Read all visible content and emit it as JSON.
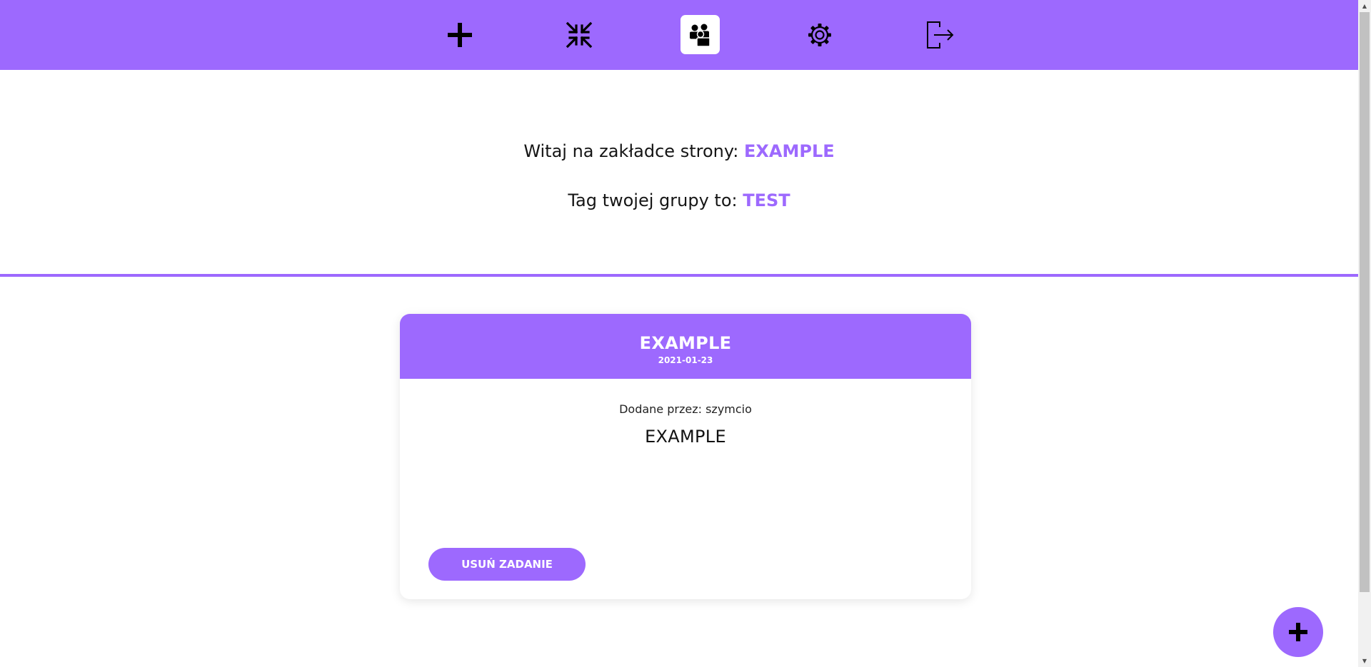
{
  "nav": {
    "items": [
      {
        "icon": "plus-icon"
      },
      {
        "icon": "compress-icon"
      },
      {
        "icon": "group-icon",
        "active": true
      },
      {
        "icon": "gear-icon"
      },
      {
        "icon": "logout-icon"
      }
    ]
  },
  "welcome": {
    "line1_prefix": "Witaj na zakładce strony: ",
    "line1_value": "EXAMPLE",
    "line2_prefix": "Tag twojej grupy to: ",
    "line2_value": "TEST"
  },
  "task": {
    "title": "EXAMPLE",
    "date": "2021-01-23",
    "author": "Dodane przez: szymcio",
    "content": "EXAMPLE",
    "delete_label": "USUŃ ZADANIE"
  },
  "fab": {
    "icon": "plus-icon"
  },
  "colors": {
    "accent": "#9d69fe",
    "background": "#ffffff",
    "text": "#151515"
  }
}
